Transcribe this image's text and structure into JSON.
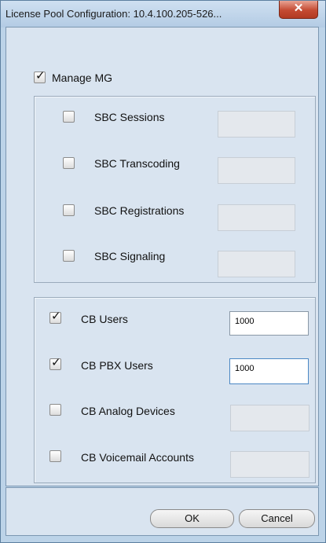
{
  "window": {
    "title": "License Pool Configuration: 10.4.100.205-526...",
    "close_glyph": "✕"
  },
  "manage_mg": {
    "label": "Manage MG",
    "checked": true
  },
  "sbc": [
    {
      "label": "SBC Sessions",
      "checked": false,
      "value": ""
    },
    {
      "label": "SBC Transcoding",
      "checked": false,
      "value": ""
    },
    {
      "label": "SBC Registrations",
      "checked": false,
      "value": ""
    },
    {
      "label": "SBC Signaling",
      "checked": false,
      "value": ""
    }
  ],
  "cb": [
    {
      "label": "CB Users",
      "checked": true,
      "value": "1000"
    },
    {
      "label": "CB PBX Users",
      "checked": true,
      "value": "1000"
    },
    {
      "label": "CB Analog Devices",
      "checked": false,
      "value": ""
    },
    {
      "label": "CB Voicemail Accounts",
      "checked": false,
      "value": ""
    }
  ],
  "buttons": {
    "ok": "OK",
    "cancel": "Cancel"
  },
  "check_glyph": "✓",
  "colors": {
    "window_bg": "#d9e4f0",
    "frame": "#bcd3e8",
    "close": "#c44a32"
  }
}
